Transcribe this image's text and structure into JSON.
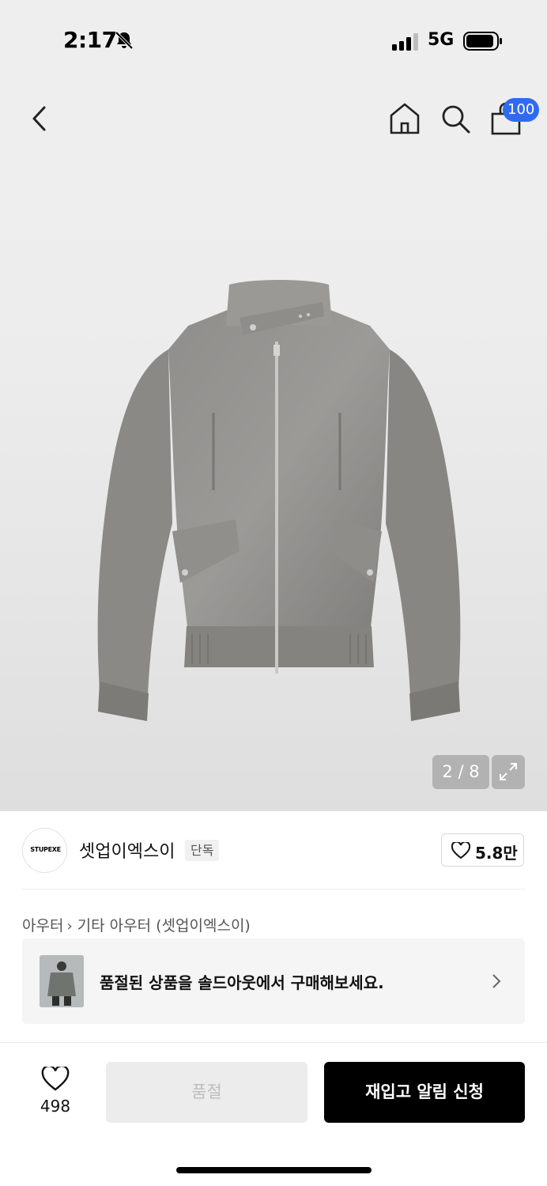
{
  "status_bar": {
    "time": "2:17",
    "network": "5G",
    "icons": [
      "bell-slash-icon",
      "signal-icon",
      "battery-icon"
    ]
  },
  "nav": {
    "icons": [
      "back-arrow-icon",
      "home-icon",
      "search-icon",
      "shopping-bag-icon"
    ],
    "cart_badge": "100"
  },
  "gallery": {
    "counter": "2 / 8",
    "expand_icon": "expand-arrows-icon"
  },
  "brand": {
    "logo_text": "STUPEXE",
    "name": "셋업이엑스이",
    "tag": "단독",
    "like_count": "5.8만"
  },
  "category": {
    "level1": "아우터",
    "level2": "기타 아우터 (셋업이엑스이)"
  },
  "soldout_banner": {
    "text": "품절된 상품을 솔드아웃에서 구매해보세요."
  },
  "bottom_bar": {
    "wish_count": "498",
    "soldout_label": "품절",
    "restock_label": "재입고 알림 신청"
  },
  "colors": {
    "accent_badge": "#2f6bf2",
    "primary_button": "#000000",
    "disabled_button": "#ececec"
  }
}
